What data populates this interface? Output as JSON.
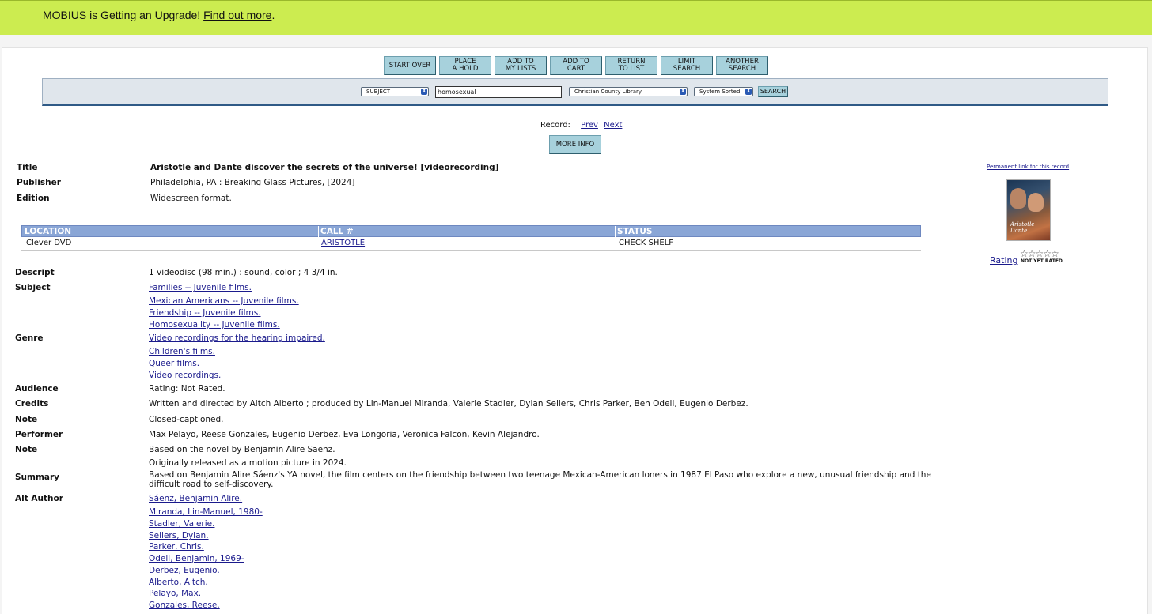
{
  "banner": {
    "text": "MOBIUS is Getting an Upgrade! ",
    "link": "Find out more",
    "period": "."
  },
  "nav_buttons": [
    [
      "START OVER"
    ],
    [
      "PLACE",
      "A HOLD"
    ],
    [
      "ADD TO",
      "MY LISTS"
    ],
    [
      "ADD TO",
      "CART"
    ],
    [
      "RETURN",
      "TO LIST"
    ],
    [
      "LIMIT",
      "SEARCH"
    ],
    [
      "ANOTHER",
      "SEARCH"
    ]
  ],
  "search": {
    "type": "SUBJECT",
    "query": "homosexual",
    "library": "Christian County Library",
    "sort": "System Sorted",
    "button": "SEARCH"
  },
  "record_nav": {
    "label": "Record:",
    "prev": "Prev",
    "next": "Next"
  },
  "more_info": "MORE INFO",
  "details": {
    "title_label": "Title",
    "title": "Aristotle and Dante discover the secrets of the universe! [videorecording]",
    "publisher_label": "Publisher",
    "publisher": "Philadelphia, PA : Breaking Glass Pictures, [2024]",
    "edition_label": "Edition",
    "edition": "Widescreen format."
  },
  "holdings": {
    "headers": [
      "LOCATION",
      "CALL #",
      "STATUS"
    ],
    "row": {
      "location": "Clever DVD",
      "call": "ARISTOTLE",
      "status": "CHECK SHELF"
    }
  },
  "fields": {
    "descript_label": "Descript",
    "descript": "1 videodisc (98 min.) : sound, color ; 4 3/4 in.",
    "subject_label": "Subject",
    "subjects": [
      "Families -- Juvenile films.",
      "Mexican Americans -- Juvenile films.",
      "Friendship -- Juvenile films.",
      "Homosexuality -- Juvenile films."
    ],
    "genre_label": "Genre",
    "genres": [
      "Video recordings for the hearing impaired.",
      "Children's films.",
      "Queer films.",
      "Video recordings."
    ],
    "audience_label": "Audience",
    "audience": "Rating: Not Rated.",
    "credits_label": "Credits",
    "credits": "Written and directed by Aitch Alberto ; produced by Lin-Manuel Miranda, Valerie Stadler, Dylan Sellers, Chris Parker, Ben Odell, Eugenio Derbez.",
    "note_label": "Note",
    "note1": "Closed-captioned.",
    "performer_label": "Performer",
    "performer": "Max Pelayo, Reese Gonzales, Eugenio Derbez, Eva Longoria, Veronica Falcon, Kevin Alejandro.",
    "note2_label": "Note",
    "note2a": "Based on the novel by Benjamin Alire Saenz.",
    "note2b": "Originally released as a motion picture in 2024.",
    "summary_label": "Summary",
    "summary1": "Based on Benjamin Alire Sáenz's YA novel, the film centers on the friendship between two teenage Mexican-American loners in 1987 El Paso who explore a new, unusual friendship and the",
    "summary2": "difficult road to self-discovery.",
    "altauthor_label": "Alt Author",
    "altauthors": [
      "Sáenz, Benjamin Alire.",
      "Miranda, Lin-Manuel, 1980-",
      "Stadler, Valerie.",
      "Sellers, Dylan.",
      "Parker, Chris.",
      "Odell, Benjamin, 1969-",
      "Derbez, Eugenio.",
      "Alberto, Aitch.",
      "Pelayo, Max.",
      "Gonzales, Reese."
    ]
  },
  "sidebar": {
    "permanent_link": "Permanent link for this record",
    "cover_text": "Aristotle Dante",
    "rating_label": "Rating",
    "stars": "☆☆☆☆☆",
    "not_yet_rated": "NOT YET RATED"
  }
}
